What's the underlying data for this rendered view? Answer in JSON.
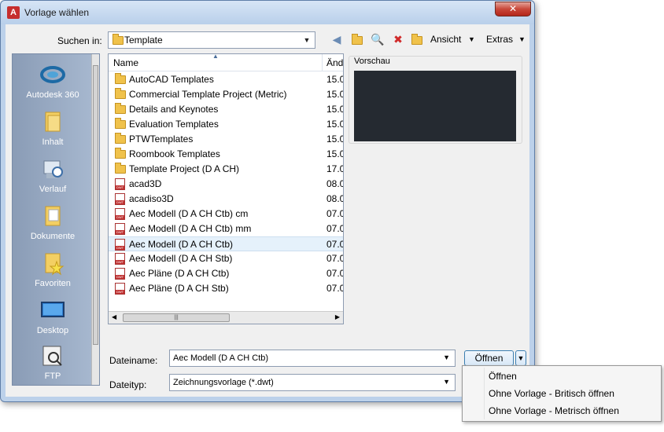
{
  "window": {
    "title": "Vorlage wählen",
    "close_label": "✕"
  },
  "toolbar": {
    "lookin_label": "Suchen in:",
    "lookin_value": "Template",
    "view_label": "Ansicht",
    "tools_label": "Extras"
  },
  "places": [
    {
      "label": "Autodesk 360",
      "icon": "autodesk-360-icon"
    },
    {
      "label": "Inhalt",
      "icon": "folder-icon"
    },
    {
      "label": "Verlauf",
      "icon": "history-icon"
    },
    {
      "label": "Dokumente",
      "icon": "documents-icon"
    },
    {
      "label": "Favoriten",
      "icon": "favorites-icon"
    },
    {
      "label": "Desktop",
      "icon": "desktop-icon"
    },
    {
      "label": "FTP",
      "icon": "ftp-icon"
    }
  ],
  "list": {
    "col_name": "Name",
    "col_date": "Änd",
    "rows": [
      {
        "name": "AutoCAD Templates",
        "date": "15.0",
        "type": "folder"
      },
      {
        "name": "Commercial Template Project (Metric)",
        "date": "15.0",
        "type": "folder"
      },
      {
        "name": "Details and Keynotes",
        "date": "15.0",
        "type": "folder"
      },
      {
        "name": "Evaluation Templates",
        "date": "15.0",
        "type": "folder"
      },
      {
        "name": "PTWTemplates",
        "date": "15.0",
        "type": "folder"
      },
      {
        "name": "Roombook Templates",
        "date": "15.0",
        "type": "folder"
      },
      {
        "name": "Template Project (D A CH)",
        "date": "17.0",
        "type": "folder"
      },
      {
        "name": "acad3D",
        "date": "08.0",
        "type": "dwt"
      },
      {
        "name": "acadiso3D",
        "date": "08.0",
        "type": "dwt"
      },
      {
        "name": "Aec Modell (D A CH Ctb) cm",
        "date": "07.0",
        "type": "dwt"
      },
      {
        "name": "Aec Modell (D A CH Ctb) mm",
        "date": "07.0",
        "type": "dwt"
      },
      {
        "name": "Aec Modell (D A CH Ctb)",
        "date": "07.0",
        "type": "dwt",
        "selected": true
      },
      {
        "name": "Aec Modell (D A CH Stb)",
        "date": "07.0",
        "type": "dwt"
      },
      {
        "name": "Aec Pläne (D A CH Ctb)",
        "date": "07.0",
        "type": "dwt"
      },
      {
        "name": "Aec Pläne (D A CH Stb)",
        "date": "07.0",
        "type": "dwt"
      }
    ]
  },
  "preview": {
    "label": "Vorschau"
  },
  "fields": {
    "filename_label": "Dateiname:",
    "filename_value": "Aec Modell (D A CH Ctb)",
    "filetype_label": "Dateityp:",
    "filetype_value": "Zeichnungsvorlage (*.dwt)",
    "open_label": "Öffnen"
  },
  "menu": [
    "Öffnen",
    "Ohne Vorlage - Britisch öffnen",
    "Ohne Vorlage - Metrisch öffnen"
  ],
  "colors": {
    "selection": "#e5f1fb",
    "preview_bg": "#252a31",
    "places_bg": "#8a9cb6"
  }
}
